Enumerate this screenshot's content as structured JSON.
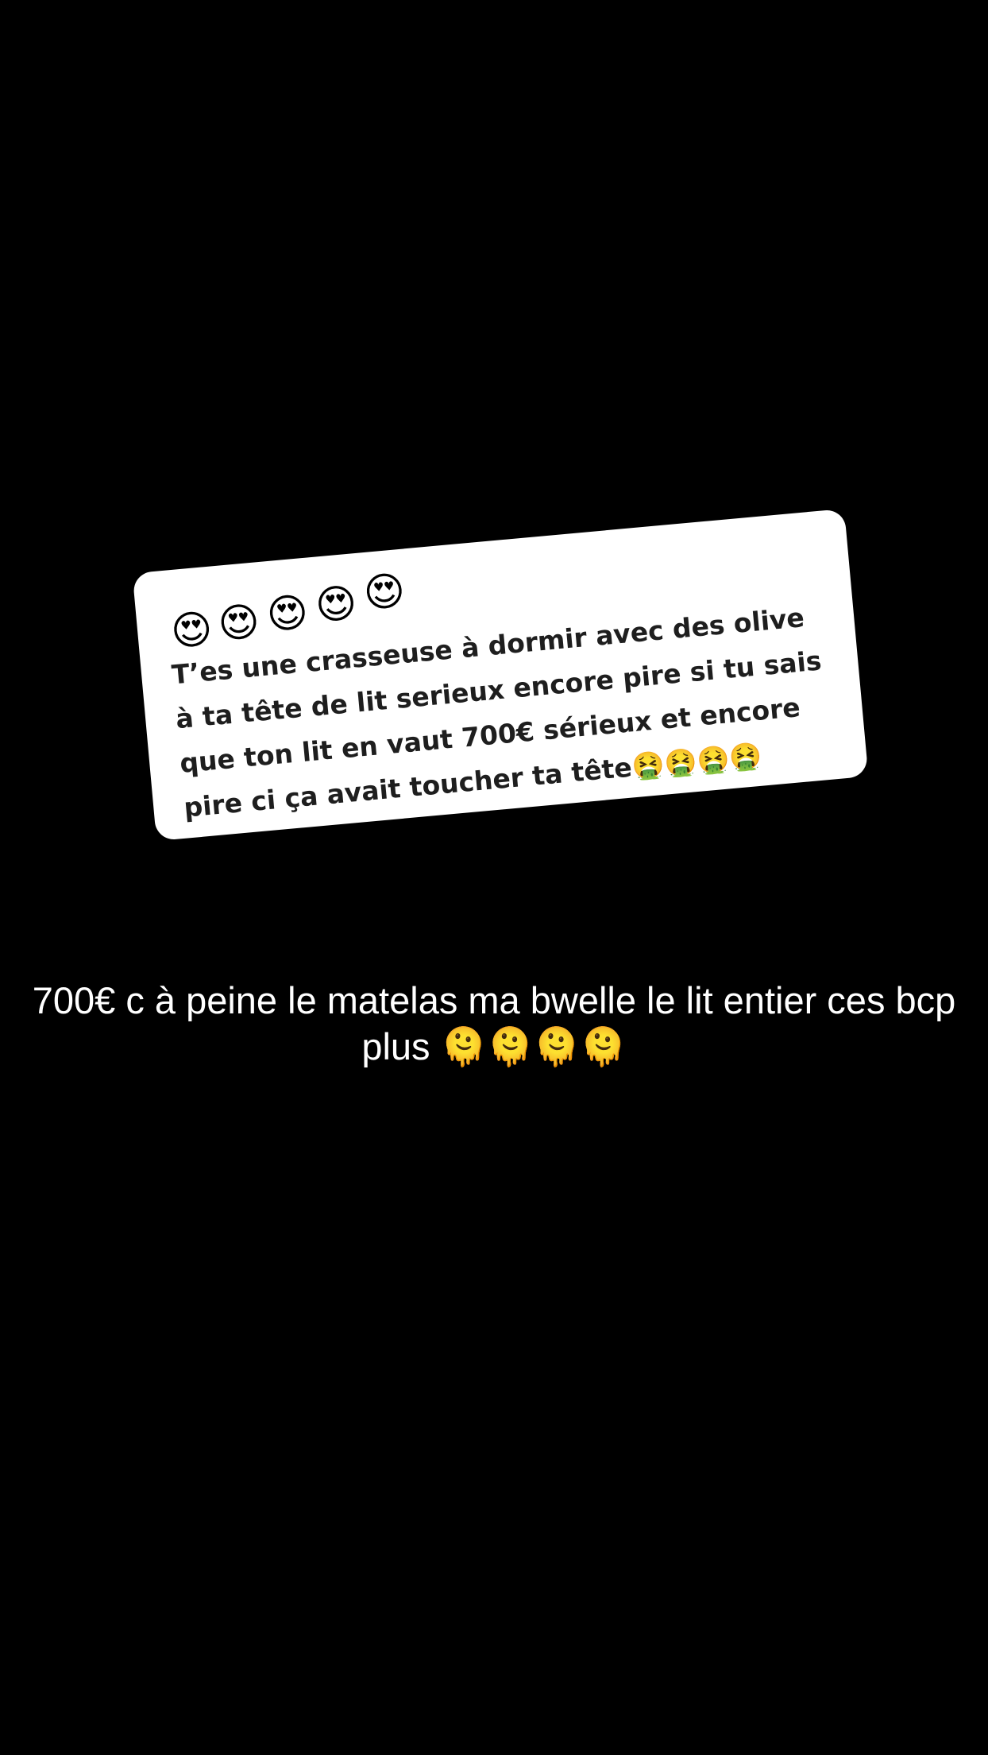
{
  "question_card": {
    "header_emojis": [
      "😍",
      "😍",
      "😍",
      "😍",
      "😍"
    ],
    "text": "T’es une crasseuse à dormir avec des olive à ta tête de lit serieux encore pire si tu sais que ton lit en vaut 700€ sérieux et encore pire ci ça avait toucher ta tête🤮🤮🤮🤮",
    "header_icon": "heart-eyes-emoji-icon"
  },
  "reply": {
    "text": "700€ c à peine le matelas ma bwelle le lit entier ces bcp plus 🫠🫠🫠🫠"
  },
  "colors": {
    "background": "#000000",
    "card_background": "#ffffff",
    "card_text": "#1e1e1e",
    "reply_text": "#ffffff"
  }
}
